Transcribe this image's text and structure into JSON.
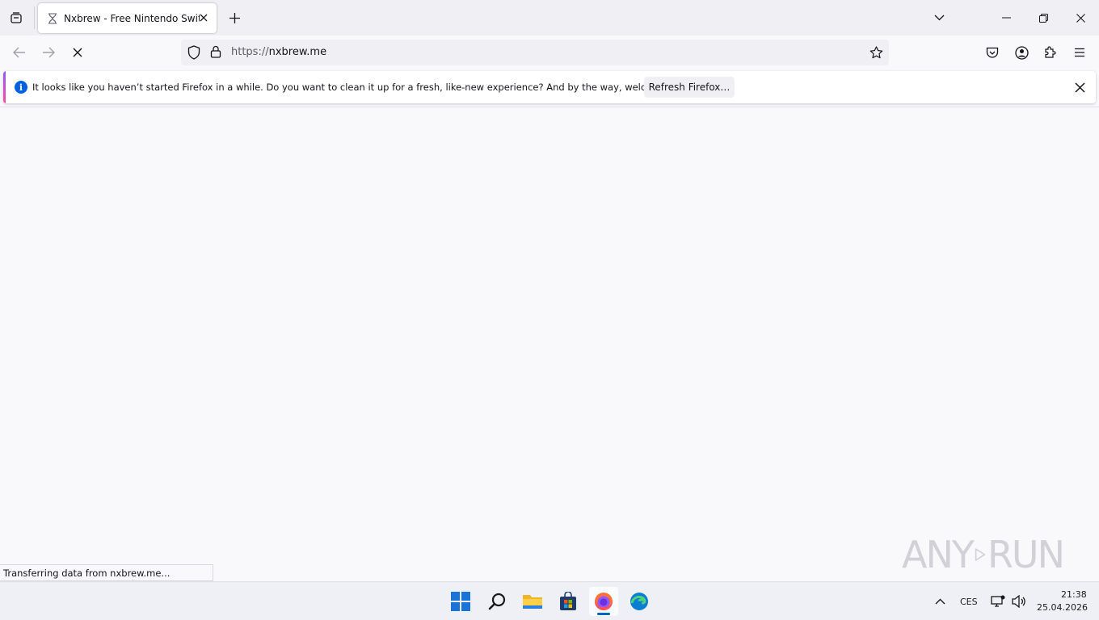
{
  "tab": {
    "title": "Nxbrew - Free Nintendo Switch"
  },
  "urlbar": {
    "scheme": "https://",
    "host": "nxbrew.me"
  },
  "notification": {
    "message": "It looks like you haven’t started Firefox in a while. Do you want to clean it up for a fresh, like-new experience? And by the way, welcome back!",
    "button_label": "Refresh Firefox…"
  },
  "status": {
    "text": "Transferring data from nxbrew.me..."
  },
  "watermark": {
    "left": "ANY",
    "right": "RUN"
  },
  "taskbar": {
    "language": "CES",
    "time": "21:38",
    "date": "25.04.2026",
    "apps": [
      "start-icon",
      "search-icon",
      "file-explorer-icon",
      "microsoft-store-icon",
      "firefox-icon",
      "edge-icon"
    ]
  },
  "colors": {
    "accent": "#0061e0",
    "toolbar": "#f9f9fb",
    "tabstrip": "#f0f0f4"
  }
}
